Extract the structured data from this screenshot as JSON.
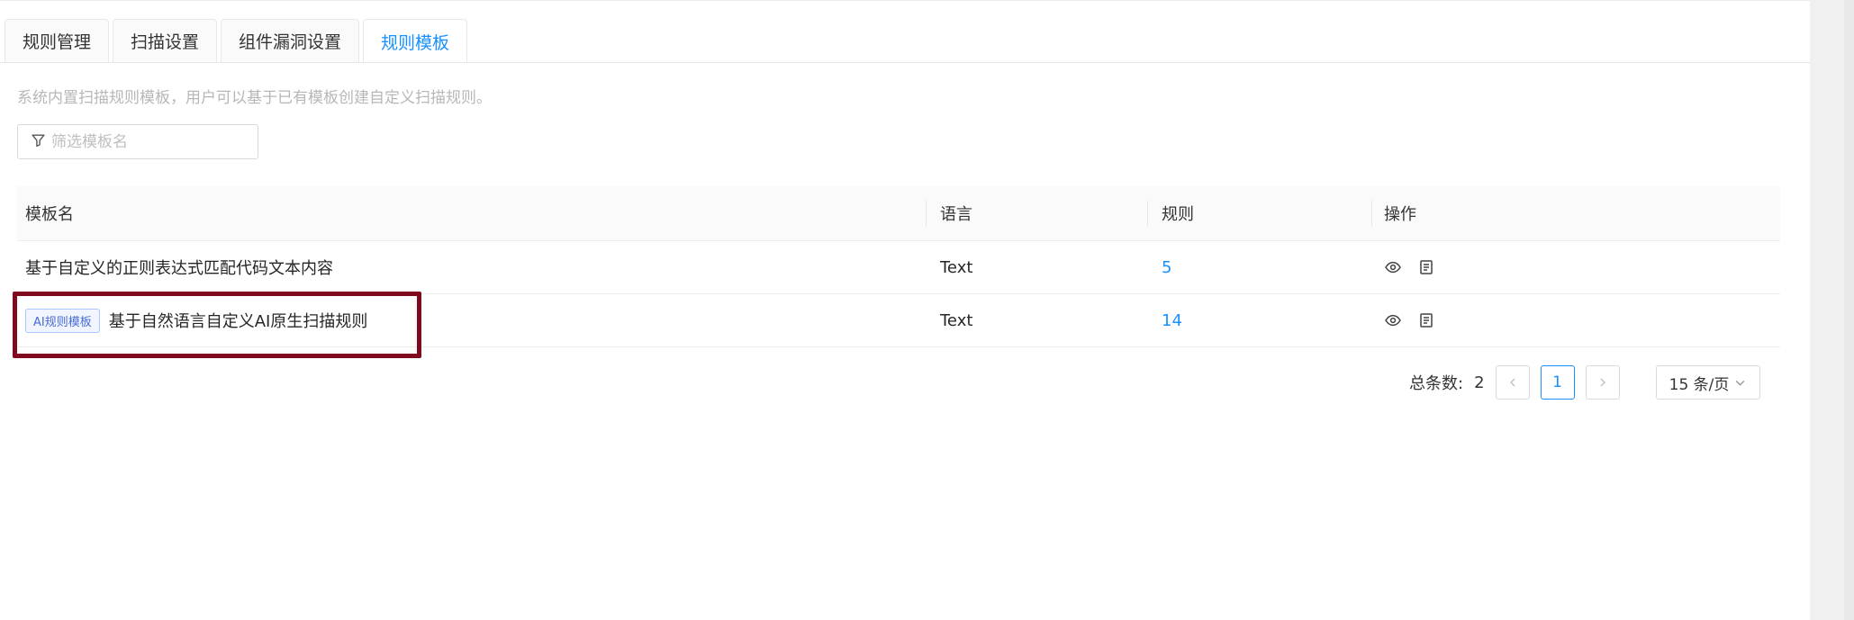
{
  "tabs": [
    {
      "label": "规则管理",
      "active": false
    },
    {
      "label": "扫描设置",
      "active": false
    },
    {
      "label": "组件漏洞设置",
      "active": false
    },
    {
      "label": "规则模板",
      "active": true
    }
  ],
  "description": "系统内置扫描规则模板，用户可以基于已有模板创建自定义扫描规则。",
  "filter": {
    "placeholder": "筛选模板名",
    "value": "",
    "icon": "filter-icon"
  },
  "table": {
    "columns": [
      "模板名",
      "语言",
      "规则",
      "操作"
    ],
    "rows": [
      {
        "tag": "",
        "name": "基于自定义的正则表达式匹配代码文本内容",
        "language": "Text",
        "rules": "5",
        "actions": [
          "eye-icon",
          "document-icon"
        ]
      },
      {
        "tag": "AI规则模板",
        "name": "基于自然语言自定义AI原生扫描规则",
        "language": "Text",
        "rules": "14",
        "actions": [
          "eye-icon",
          "document-icon"
        ]
      }
    ]
  },
  "pagination": {
    "total_label": "总条数:",
    "total": "2",
    "current_page": "1",
    "page_size": "15 条/页"
  },
  "colors": {
    "accent": "#1890ff",
    "highlight": "#7f0a1e"
  }
}
